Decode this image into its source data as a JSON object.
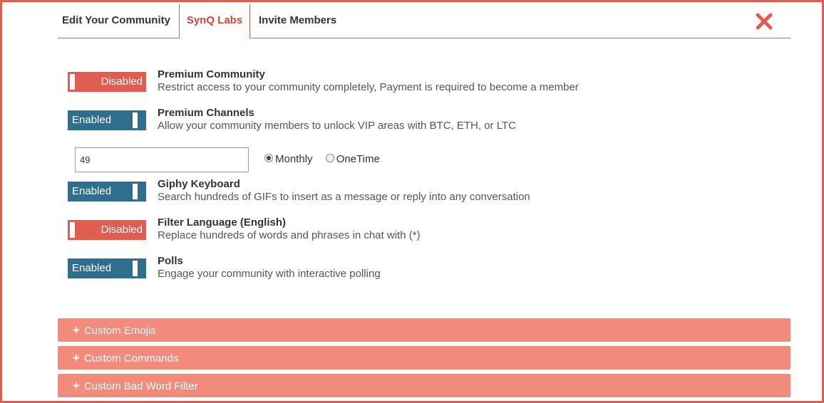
{
  "tabs": [
    {
      "label": "Edit Your Community"
    },
    {
      "label": "SynQ Labs"
    },
    {
      "label": "Invite Members"
    }
  ],
  "colors": {
    "accent": "#e25d4f",
    "enabled": "#2e6e8e",
    "accordion": "#f28b7c"
  },
  "features": [
    {
      "state": "Disabled",
      "title": "Premium Community",
      "desc": "Restrict access to your community completely, Payment is required to become a member"
    },
    {
      "state": "Enabled",
      "title": "Premium Channels",
      "desc": "Allow your community members to unlock VIP areas with BTC, ETH, or LTC"
    },
    {
      "state": "Enabled",
      "title": "Giphy Keyboard",
      "desc": "Search hundreds of GIFs to insert as a message or reply into any conversation"
    },
    {
      "state": "Disabled",
      "title": "Filter Language (English)",
      "desc": "Replace hundreds of words and phrases in chat with (*)"
    },
    {
      "state": "Enabled",
      "title": "Polls",
      "desc": "Engage your community with interactive polling"
    }
  ],
  "price": {
    "value": "49"
  },
  "billing": {
    "options": [
      "Monthly",
      "OneTime"
    ],
    "selected": "Monthly"
  },
  "accordions": [
    {
      "icon": "+",
      "label": "Custom Emojis"
    },
    {
      "icon": "+",
      "label": "Custom Commands"
    },
    {
      "icon": "+",
      "label": "Custom Bad Word Filter"
    }
  ]
}
